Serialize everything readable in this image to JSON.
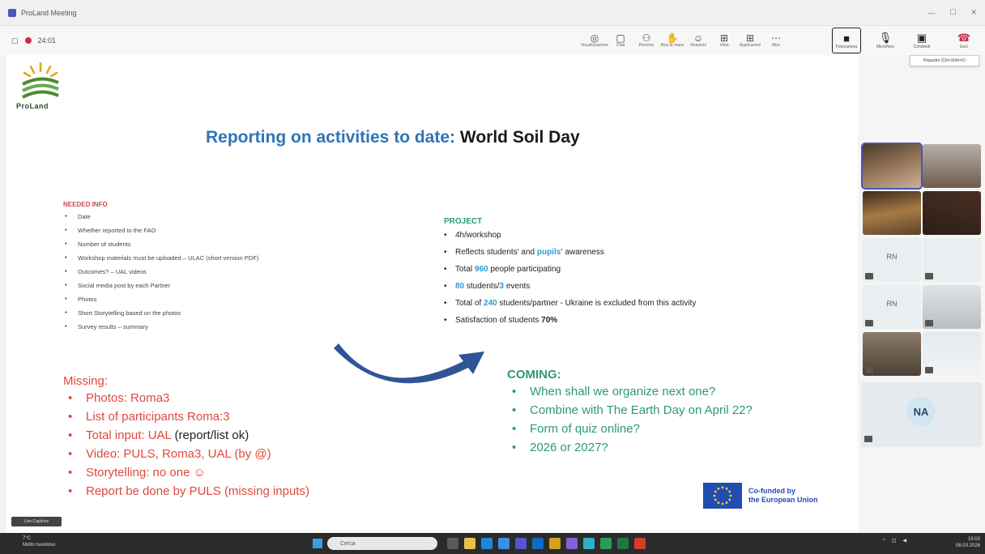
{
  "window": {
    "title": "ProLand Meeting",
    "timer": "24:01"
  },
  "toolbar": {
    "tools": [
      {
        "icon": "people-view-icon",
        "glyph": "◎",
        "label": "Visualizzazione"
      },
      {
        "icon": "chat-icon",
        "glyph": "▢",
        "label": "Chat"
      },
      {
        "icon": "people-icon",
        "glyph": "⚇",
        "label": "Persone"
      },
      {
        "icon": "raise-hand-icon",
        "glyph": "✋",
        "label": "Alza la mano"
      },
      {
        "icon": "react-icon",
        "glyph": "☺",
        "label": "Reazioni"
      },
      {
        "icon": "view-icon",
        "glyph": "⊞",
        "label": "Vista"
      },
      {
        "icon": "apps-icon",
        "glyph": "⊞",
        "label": "Applicazioni"
      },
      {
        "icon": "more-icon",
        "glyph": "⋯",
        "label": "Altro"
      }
    ],
    "camera_label": "Fotocamera",
    "mic_label": "Microfono",
    "share_label": "Condividi",
    "leave_label": "Esci"
  },
  "slide": {
    "logo_text": "ProLand",
    "title_blue": "Reporting on activities to date:",
    "title_black": "World Soil Day",
    "needed": {
      "heading": "NEEDED INFO",
      "items": [
        "Date",
        "Whether reported to the FAO",
        "Number of students",
        "Workshop materials must be uploaded – ULAC (short version PDF)",
        "Outcomes? – UAL videos",
        "Social media post by each Partner",
        "Photos",
        "Short Storytelling based on the photos",
        "Survey results – summary"
      ]
    },
    "project": {
      "heading": "PROJECT",
      "item1": "4h/workshop",
      "item2_a": "Reflects students' and ",
      "item2_b": "pupils'",
      "item2_c": " awareness",
      "item3_a": "Total ",
      "item3_b": "960",
      "item3_c": " people participating",
      "item4_a": "80",
      "item4_b": " students/",
      "item4_c": "3",
      "item4_d": " events",
      "item5_a": "Total of ",
      "item5_b": "240",
      "item5_c": " students/partner - Ukraine is excluded from this activity",
      "item6_a": "Satisfaction of students ",
      "item6_b": "70%"
    },
    "missing": {
      "heading": "Missing:",
      "item1": "Photos: Roma3",
      "item2": "List of participants Roma:3",
      "item3_a": "Total input: UAL ",
      "item3_b": "(report/list ok)",
      "item4": "Video: PULS, Roma3, UAL (by @)",
      "item5": "Storytelling: no one ☺",
      "item6": "Report be done by PULS (missing inputs)"
    },
    "coming": {
      "heading": "COMING:",
      "items": [
        "When shall we organize next one?",
        "Combine with The Earth Day on April 22?",
        "Form of quiz online?",
        "2026 or 2027?"
      ]
    },
    "eu_line1": "Co-funded by",
    "eu_line2": "the European Union"
  },
  "caption_button": "Live Captions",
  "panel": {
    "tooltip": "Riquadro (Ctrl+Shift+K)",
    "initials_1": "RN",
    "initials_2": "RN",
    "initials_3": "NA"
  },
  "taskbar": {
    "weather_temp": "7°C",
    "weather_desc": "Molto nuvoloso",
    "search_placeholder": "Cerca",
    "time": "15:02",
    "date": "06.03.2026"
  }
}
